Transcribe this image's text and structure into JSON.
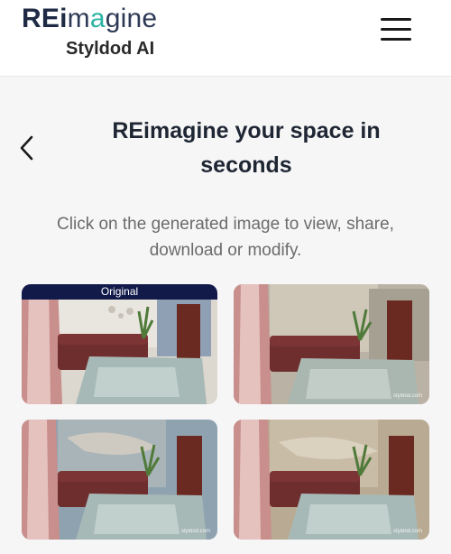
{
  "header": {
    "logo": {
      "part1": "REi",
      "part2": "m",
      "part3": "a",
      "part4": "gi",
      "part5": "ne"
    },
    "brand": "Styldod AI",
    "menu_icon": "hamburger-menu-icon"
  },
  "page": {
    "back_icon": "chevron-left-icon",
    "title_line1": "REimagine your space in",
    "title_line2": "seconds",
    "subtitle_line1": "Click on the generated image to view, share,",
    "subtitle_line2": "download or modify."
  },
  "gallery": {
    "original_label": "Original",
    "watermark": "styldod.com"
  },
  "colors": {
    "brand_dark": "#1f2a44",
    "brand_teal": "#2bb3a3",
    "badge_bg": "#121a4a"
  }
}
